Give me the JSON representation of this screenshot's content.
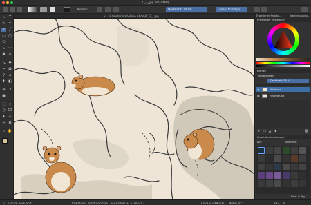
{
  "window": {
    "title": "C_3_.jpg (80,7 MiB)",
    "dot_colors": [
      "#ff5f57",
      "#febc2e",
      "#28c840"
    ]
  },
  "toolbar": {
    "blend_mode": "Normal",
    "opacity_label": "Deckkraft: 100 %",
    "size_label": "Größe: 65,00 px"
  },
  "document_tab": {
    "title": "Hamster im hohlen Ahorn(C_3_).jpg"
  },
  "dock": {
    "tabs": [
      "Erweiterter Farbwä…",
      "Werkzeugoptio…"
    ],
    "color_panel_title": "Erweiterter Farbwähler",
    "layers_panel_title": "Ebenen",
    "layer_blend": "Multiplizieren",
    "layer_opacity": "Deckkraft: 15 %",
    "layers": [
      {
        "name": "Malebene 1",
        "selected": true
      },
      {
        "name": "Hintergrund",
        "selected": false
      }
    ],
    "brush_panel_title": "Pinsel-Voreinstellungen",
    "brush_filter": "Alle",
    "brush_tag": "Stichwort",
    "brush_search_label": "Filter in Tag"
  },
  "status": {
    "brush_name": "i) Charcoal Rock Soft",
    "color_info": "RGB/Alpha (8-bit Ganzzah…and) sRGB IEC61966-2.1",
    "image_info": "3.023 x 2.493 (80,7 MiB)",
    "rotation": "0,00°",
    "zoom": "393,3 %"
  },
  "colors": {
    "accent": "#4a6fa5",
    "canvas_bg": "#eee5d6",
    "layer_selected": "#3d6ea5",
    "foreground_swatch": "#d8c29e",
    "fur": "#c98a4b"
  }
}
